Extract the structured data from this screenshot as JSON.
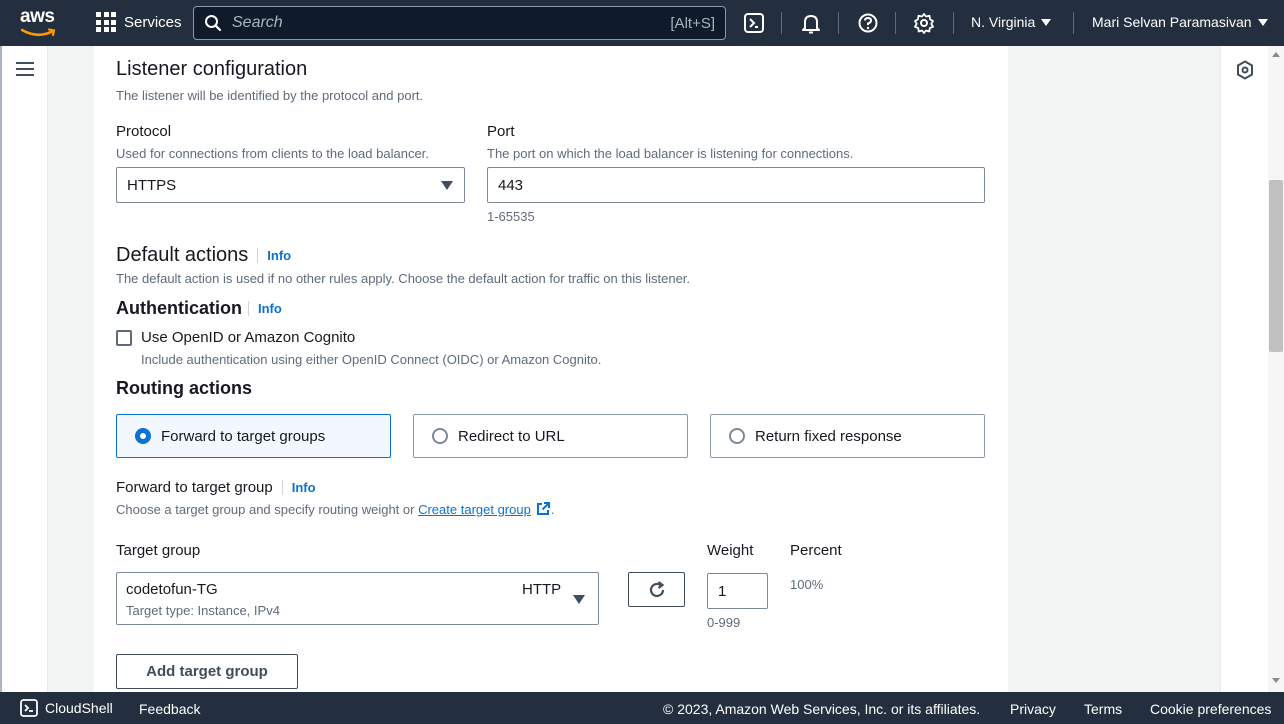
{
  "topbar": {
    "logo_text": "aws",
    "services_label": "Services",
    "search_placeholder": "Search",
    "search_shortcut": "[Alt+S]",
    "region": "N. Virginia",
    "user": "Mari Selvan Paramasivan"
  },
  "listener": {
    "title": "Listener configuration",
    "description": "The listener will be identified by the protocol and port.",
    "protocol_label": "Protocol",
    "protocol_desc": "Used for connections from clients to the load balancer.",
    "protocol_value": "HTTPS",
    "port_label": "Port",
    "port_desc": "The port on which the load balancer is listening for connections.",
    "port_value": "443",
    "port_hint": "1-65535"
  },
  "default_actions": {
    "title": "Default actions",
    "info": "Info",
    "description": "The default action is used if no other rules apply. Choose the default action for traffic on this listener."
  },
  "authentication": {
    "title": "Authentication",
    "info": "Info",
    "checkbox_label": "Use OpenID or Amazon Cognito",
    "checkbox_desc": "Include authentication using either OpenID Connect (OIDC) or Amazon Cognito."
  },
  "routing": {
    "title": "Routing actions",
    "options": [
      "Forward to target groups",
      "Redirect to URL",
      "Return fixed response"
    ],
    "selected": "Forward to target groups"
  },
  "forward": {
    "title": "Forward to target group",
    "info": "Info",
    "description": "Choose a target group and specify routing weight or",
    "link": "Create target group",
    "link_suffix": ".",
    "target_group_label": "Target group",
    "weight_label": "Weight",
    "percent_label": "Percent",
    "tg_name": "codetofun-TG",
    "tg_protocol": "HTTP",
    "tg_type": "Target type: Instance, IPv4",
    "weight_value": "1",
    "weight_hint": "0-999",
    "percent_value": "100%",
    "add_button": "Add target group"
  },
  "footer": {
    "cloudshell": "CloudShell",
    "feedback": "Feedback",
    "copyright": "© 2023, Amazon Web Services, Inc. or its affiliates.",
    "privacy": "Privacy",
    "terms": "Terms",
    "cookies": "Cookie preferences"
  },
  "colors": {
    "topbar_bg": "#232f3e",
    "accent": "#0972d3",
    "text": "#16191f",
    "muted": "#5f6b7a"
  },
  "icons": [
    "aws-logo",
    "services-grid-icon",
    "search-icon",
    "cloudshell-icon",
    "notifications-bell-icon",
    "help-icon",
    "settings-gear-icon",
    "hamburger-menu-icon",
    "refresh-icon",
    "external-link-icon",
    "tools-panel-icon"
  ]
}
